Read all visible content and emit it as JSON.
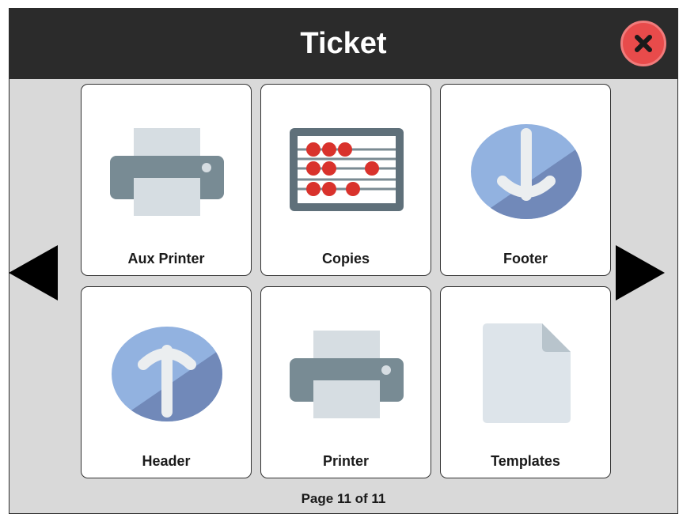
{
  "dialog": {
    "title": "Ticket",
    "close_icon": "close-icon",
    "prev_icon": "arrow-left-icon",
    "next_icon": "arrow-right-icon"
  },
  "tiles": [
    {
      "label": "Aux Printer",
      "icon": "printer-icon"
    },
    {
      "label": "Copies",
      "icon": "abacus-icon"
    },
    {
      "label": "Footer",
      "icon": "arrow-down-icon"
    },
    {
      "label": "Header",
      "icon": "arrow-up-icon"
    },
    {
      "label": "Printer",
      "icon": "printer-icon"
    },
    {
      "label": "Templates",
      "icon": "document-icon"
    }
  ],
  "pagination": {
    "text": "Page 11 of 11"
  },
  "colors": {
    "titlebar": "#2b2b2b",
    "background": "#d9d9d9",
    "close": "#e84b4b",
    "printer_body": "#788b94",
    "paper": "#d6dde2",
    "abacus_bead": "#d9322c",
    "circle_light": "#92b2e0",
    "circle_dark": "#7189b9"
  }
}
